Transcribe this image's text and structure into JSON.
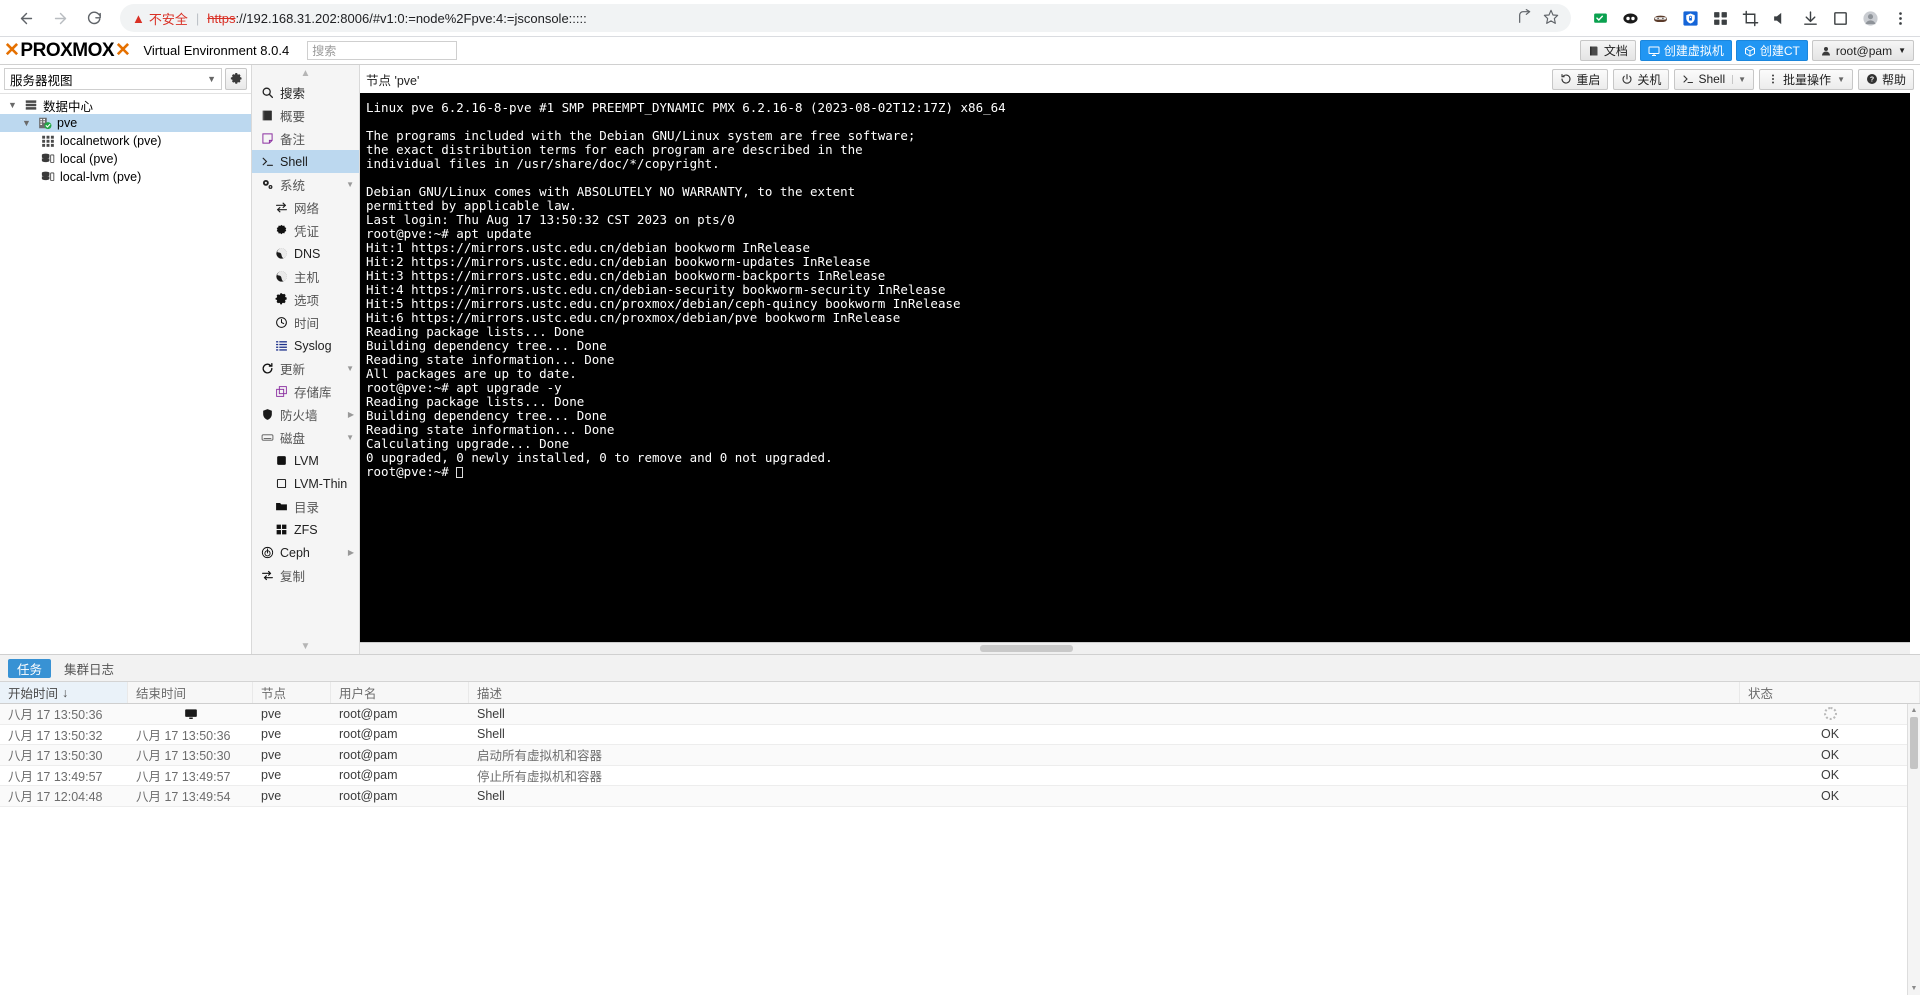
{
  "browser": {
    "back_icon": "back-arrow-icon",
    "forward_icon": "forward-arrow-icon",
    "reload_icon": "reload-icon",
    "security_label": "不安全",
    "url_scheme": "https",
    "url_rest": "://192.168.31.202:8006/#v1:0:=node%2Fpve:4:=jsconsole:::::",
    "share_icon": "share-icon",
    "bookmark_icon": "star-icon",
    "extensions": [
      "green-flag-icon",
      "eyes-icon",
      "mask-icon",
      "shield-lock-icon",
      "grid-apps-icon",
      "crop-icon",
      "speaker-icon",
      "download-icon",
      "sidebar-panel-icon"
    ],
    "profile_icon": "avatar-icon",
    "menu_icon": "three-dot-menu-icon"
  },
  "header": {
    "logo_text": "PROXMOX",
    "product_name": "Virtual Environment 8.0.4",
    "search_placeholder": "搜索",
    "docs_label": "文档",
    "create_vm_label": "创建虚拟机",
    "create_ct_label": "创建CT",
    "user_label": "root@pam",
    "accent_blue": "#2196f3"
  },
  "tree": {
    "view_label": "服务器视图",
    "gear_icon": "gear-icon",
    "items": [
      {
        "label": "数据中心",
        "icon": "datacenter-icon",
        "depth": 0,
        "expanded": true,
        "selected": false
      },
      {
        "label": "pve",
        "icon": "node-online-icon",
        "depth": 1,
        "expanded": true,
        "selected": true
      },
      {
        "label": "localnetwork (pve)",
        "icon": "network-grid-icon",
        "depth": 2,
        "expanded": false,
        "selected": false
      },
      {
        "label": "local (pve)",
        "icon": "storage-icon",
        "depth": 2,
        "expanded": false,
        "selected": false
      },
      {
        "label": "local-lvm (pve)",
        "icon": "storage-icon",
        "depth": 2,
        "expanded": false,
        "selected": false
      }
    ]
  },
  "nav": {
    "items": [
      {
        "label": "搜索",
        "icon": "search-icon",
        "indent": false,
        "selected": false,
        "submenu": false
      },
      {
        "label": "概要",
        "icon": "book-icon",
        "indent": false,
        "selected": false,
        "submenu": false
      },
      {
        "label": "备注",
        "icon": "note-icon",
        "indent": false,
        "selected": false,
        "submenu": false
      },
      {
        "label": "Shell",
        "icon": "shell-prompt-icon",
        "indent": false,
        "selected": true,
        "submenu": false
      },
      {
        "label": "系统",
        "icon": "system-gears-icon",
        "indent": false,
        "selected": false,
        "submenu": true
      },
      {
        "label": "网络",
        "icon": "network-arrows-icon",
        "indent": true,
        "selected": false,
        "submenu": false
      },
      {
        "label": "凭证",
        "icon": "certificate-icon",
        "indent": true,
        "selected": false,
        "submenu": false
      },
      {
        "label": "DNS",
        "icon": "globe-icon",
        "indent": true,
        "selected": false,
        "submenu": false
      },
      {
        "label": "主机",
        "icon": "globe-icon",
        "indent": true,
        "selected": false,
        "submenu": false
      },
      {
        "label": "选项",
        "icon": "gear-icon",
        "indent": true,
        "selected": false,
        "submenu": false
      },
      {
        "label": "时间",
        "icon": "clock-icon",
        "indent": true,
        "selected": false,
        "submenu": false
      },
      {
        "label": "Syslog",
        "icon": "list-lines-icon",
        "indent": true,
        "selected": false,
        "submenu": false
      },
      {
        "label": "更新",
        "icon": "refresh-icon",
        "indent": false,
        "selected": false,
        "submenu": true
      },
      {
        "label": "存储库",
        "icon": "repository-icon",
        "indent": true,
        "selected": false,
        "submenu": false
      },
      {
        "label": "防火墙",
        "icon": "shield-icon",
        "indent": false,
        "selected": false,
        "submenu": true
      },
      {
        "label": "磁盘",
        "icon": "disk-icon",
        "indent": false,
        "selected": false,
        "submenu": true
      },
      {
        "label": "LVM",
        "icon": "lvm-square-icon",
        "indent": true,
        "selected": false,
        "submenu": false
      },
      {
        "label": "LVM-Thin",
        "icon": "lvm-thin-icon",
        "indent": true,
        "selected": false,
        "submenu": false
      },
      {
        "label": "目录",
        "icon": "folder-icon",
        "indent": true,
        "selected": false,
        "submenu": false
      },
      {
        "label": "ZFS",
        "icon": "zfs-grid-icon",
        "indent": true,
        "selected": false,
        "submenu": false
      },
      {
        "label": "Ceph",
        "icon": "ceph-icon",
        "indent": false,
        "selected": false,
        "submenu": true
      },
      {
        "label": "复制",
        "icon": "replication-icon",
        "indent": false,
        "selected": false,
        "submenu": false
      }
    ]
  },
  "content": {
    "node_title": "节点 'pve'",
    "toolbar": {
      "restart_label": "重启",
      "shutdown_label": "关机",
      "shell_label": "Shell",
      "bulk_label": "批量操作",
      "help_label": "帮助"
    },
    "terminal_text": "Linux pve 6.2.16-8-pve #1 SMP PREEMPT_DYNAMIC PMX 6.2.16-8 (2023-08-02T12:17Z) x86_64\n\nThe programs included with the Debian GNU/Linux system are free software;\nthe exact distribution terms for each program are described in the\nindividual files in /usr/share/doc/*/copyright.\n\nDebian GNU/Linux comes with ABSOLUTELY NO WARRANTY, to the extent\npermitted by applicable law.\nLast login: Thu Aug 17 13:50:32 CST 2023 on pts/0\nroot@pve:~# apt update\nHit:1 https://mirrors.ustc.edu.cn/debian bookworm InRelease\nHit:2 https://mirrors.ustc.edu.cn/debian bookworm-updates InRelease\nHit:3 https://mirrors.ustc.edu.cn/debian bookworm-backports InRelease\nHit:4 https://mirrors.ustc.edu.cn/debian-security bookworm-security InRelease\nHit:5 https://mirrors.ustc.edu.cn/proxmox/debian/ceph-quincy bookworm InRelease\nHit:6 https://mirrors.ustc.edu.cn/proxmox/debian/pve bookworm InRelease\nReading package lists... Done\nBuilding dependency tree... Done\nReading state information... Done\nAll packages are up to date.\nroot@pve:~# apt upgrade -y\nReading package lists... Done\nBuilding dependency tree... Done\nReading state information... Done\nCalculating upgrade... Done\n0 upgraded, 0 newly installed, 0 to remove and 0 not upgraded.\nroot@pve:~# "
  },
  "bottom": {
    "tabs": [
      {
        "label": "任务",
        "active": true
      },
      {
        "label": "集群日志",
        "active": false
      }
    ],
    "columns": {
      "start": "开始时间",
      "start_sort": "↓",
      "end": "结束时间",
      "node": "节点",
      "user": "用户名",
      "desc": "描述",
      "status": "状态"
    },
    "rows": [
      {
        "start": "八月 17 13:50:36",
        "end": "",
        "end_icon": "monitor-icon",
        "node": "pve",
        "user": "root@pam",
        "desc": "Shell",
        "status": "",
        "status_icon": "spinner-icon"
      },
      {
        "start": "八月 17 13:50:32",
        "end": "八月 17 13:50:36",
        "end_icon": "",
        "node": "pve",
        "user": "root@pam",
        "desc": "Shell",
        "status": "OK",
        "status_icon": ""
      },
      {
        "start": "八月 17 13:50:30",
        "end": "八月 17 13:50:30",
        "end_icon": "",
        "node": "pve",
        "user": "root@pam",
        "desc": "启动所有虚拟机和容器",
        "status": "OK",
        "status_icon": ""
      },
      {
        "start": "八月 17 13:49:57",
        "end": "八月 17 13:49:57",
        "end_icon": "",
        "node": "pve",
        "user": "root@pam",
        "desc": "停止所有虚拟机和容器",
        "status": "OK",
        "status_icon": ""
      },
      {
        "start": "八月 17 12:04:48",
        "end": "八月 17 13:49:54",
        "end_icon": "",
        "node": "pve",
        "user": "root@pam",
        "desc": "Shell",
        "status": "OK",
        "status_icon": ""
      }
    ]
  }
}
